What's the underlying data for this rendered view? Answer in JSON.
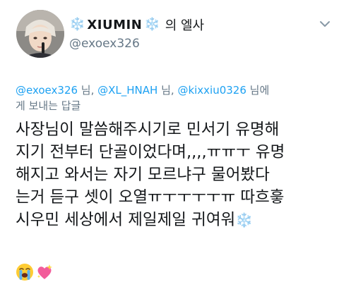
{
  "account": {
    "display_name_prefix": "❄️",
    "display_name": "XIUMIN",
    "display_name_suffix_icon": "❄️",
    "display_name_possessive": "의 엘사",
    "handle": "@exoex326"
  },
  "icons": {
    "avatar": "avatar-photo",
    "menu": "chevron-down-icon",
    "snowflake": "snowflake-icon",
    "crying": "loudly-crying-face-icon",
    "heart": "sparkling-heart-icon"
  },
  "colors": {
    "link": "#1da1f2",
    "secondary_text": "#657786",
    "primary_text": "#14171a",
    "snowflake": "#7fb6e8"
  },
  "reply_context": {
    "mention_1": "@exoex326",
    "sep_1": " 님, ",
    "mention_2": "@XL_HNAH",
    "sep_2": " 님, ",
    "mention_3": "@kixxiu0326",
    "sep_3": " 님에",
    "line_2": "게 보내는 답글"
  },
  "tweet_body": {
    "line_1": "사장님이 말씀해주시기로 민서기 유명해",
    "line_2": "지기 전부터 단골이었다며,,,,ㅠㅠㅜ 유명",
    "line_3": "해지고 와서는 자기 모르냐구 물어봤다",
    "line_4": "는거 듣구 셋이 오열ㅠㅜㅜㅜㅜㅠ 따흐흫",
    "line_5": "시우민 세상에서 제일제일 귀여워",
    "line_5_emoji": "❄️"
  }
}
